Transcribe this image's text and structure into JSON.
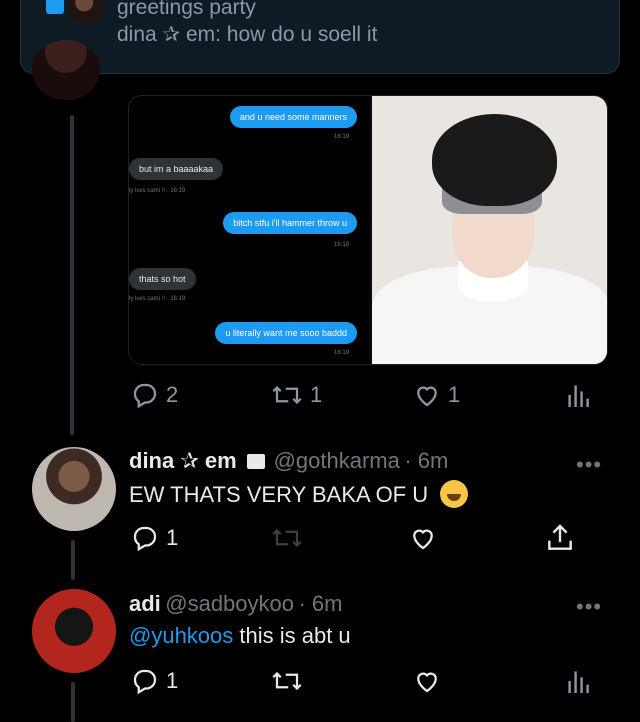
{
  "notification": {
    "title": "greetings party",
    "message": "dina ✰ em: how do u soell it"
  },
  "media": {
    "chat": [
      {
        "text": "and u need some manners",
        "direction": "out",
        "time": "16:19"
      },
      {
        "text": "but im a baaaakaa",
        "direction": "in",
        "meta": "ly luvs cami !! · 16:19"
      },
      {
        "text": "bitch stfu i'll hammer throw u",
        "direction": "out",
        "time": "16:19"
      },
      {
        "text": "thats so hot",
        "direction": "in",
        "meta": "ly luvs cami !! · 16:19"
      },
      {
        "text": "u literally want me sooo baddd",
        "direction": "out",
        "time": "16:19"
      }
    ]
  },
  "tweet_top_actions": {
    "reply_count": "2",
    "retweet_count": "1",
    "like_count": "1"
  },
  "reply1": {
    "name": "dina ✰ em",
    "handle": "@gothkarma",
    "time": "· 6m",
    "text": "EW THATS VERY BAKA OF U",
    "reply_count": "1",
    "more": "•••"
  },
  "reply2": {
    "name": "adi",
    "handle": "@sadboykoo",
    "time": "· 6m",
    "mention": "@yuhkoos",
    "text": " this is abt u",
    "reply_count": "1",
    "more": "•••"
  },
  "colors": {
    "background": "#000000",
    "accent": "#1d9bf0",
    "muted": "#71767b",
    "text": "#e7e9ea"
  }
}
